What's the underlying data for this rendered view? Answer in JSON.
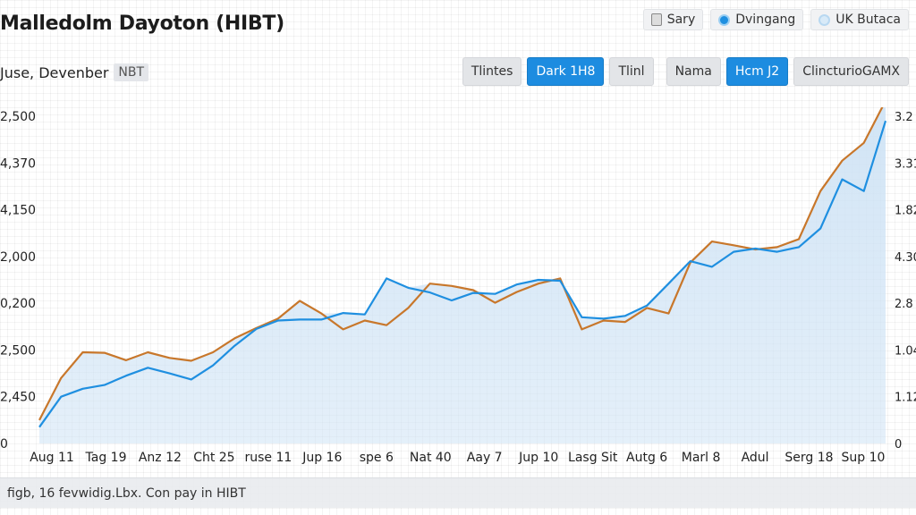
{
  "header": {
    "title": "Malledolm Dayoton (HIBT)",
    "subtitle": "Juse, Devenber",
    "subtitle_tag": "NBT"
  },
  "legend": [
    {
      "label": "Sary",
      "icon": "document-icon"
    },
    {
      "label": "Dvingang",
      "icon": "blue-dot-icon"
    },
    {
      "label": "UK Butaca",
      "icon": "light-dot-icon"
    }
  ],
  "toolbar": [
    {
      "label": "Tlintes",
      "active": false
    },
    {
      "label": "Dark 1H8",
      "active": true
    },
    {
      "label": "Tlinl",
      "active": false
    },
    {
      "label": "Nama",
      "active": false
    },
    {
      "label": "Hcm J2",
      "active": true
    },
    {
      "label": "ClincturioGAMX",
      "active": false
    }
  ],
  "footer": {
    "text": "figb, 16 fevwidig.Lbx. Con pay in HIBT"
  },
  "colors": {
    "orange_series": "#c8772b",
    "blue_series": "#1f8fe0",
    "area_fill": "#cfe3f5",
    "active_button": "#1d8ce0"
  },
  "chart_data": {
    "type": "line",
    "title": "Malledolm Dayoton (HIBT)",
    "grid": true,
    "legend_position": "top-right",
    "x_ticks": [
      "Aug 11",
      "Tag 19",
      "Anz 12",
      "Cht 25",
      "ruse 11",
      "Jup 16",
      "spe 6",
      "Nat 40",
      "Aay 7",
      "Jup 10",
      "Lasg Sit",
      "Autg 6",
      "Marl 8",
      "Adul",
      "Serg 18",
      "Sup 10"
    ],
    "y_ticks_left": [
      "0",
      "2,450",
      "2,500",
      "0,200",
      "2,000",
      "4,150",
      "4,370",
      "2,500"
    ],
    "y_ticks_right": [
      "0",
      "1.12",
      "1.04",
      "2.8",
      "4.30",
      "1.82",
      "3.31",
      "3.2"
    ],
    "ylim": [
      0,
      7
    ],
    "series": [
      {
        "color": "#c8772b",
        "values": [
          0.5,
          1.4,
          1.95,
          1.94,
          1.78,
          1.95,
          1.83,
          1.77,
          1.95,
          2.25,
          2.47,
          2.67,
          3.05,
          2.78,
          2.44,
          2.63,
          2.53,
          2.9,
          3.42,
          3.37,
          3.28,
          3.01,
          3.24,
          3.42,
          3.53,
          2.44,
          2.63,
          2.6,
          2.9,
          2.78,
          3.87,
          4.32,
          4.24,
          4.15,
          4.2,
          4.37,
          5.4,
          6.05,
          6.43,
          7.33
        ]
      },
      {
        "color": "#1f8fe0",
        "values": [
          0.35,
          1.0,
          1.17,
          1.25,
          1.45,
          1.62,
          1.5,
          1.37,
          1.67,
          2.09,
          2.45,
          2.63,
          2.65,
          2.65,
          2.79,
          2.76,
          3.53,
          3.33,
          3.23,
          3.06,
          3.22,
          3.2,
          3.4,
          3.5,
          3.48,
          2.7,
          2.67,
          2.73,
          2.95,
          3.42,
          3.9,
          3.78,
          4.1,
          4.17,
          4.1,
          4.2,
          4.6,
          5.65,
          5.4,
          6.9
        ]
      }
    ]
  }
}
